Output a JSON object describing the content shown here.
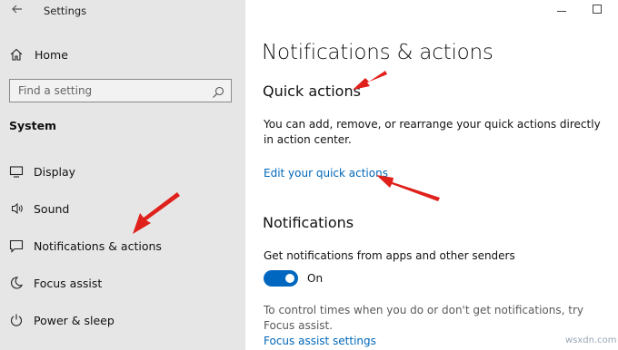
{
  "window": {
    "title": "Settings",
    "back_icon": "back-arrow-icon",
    "controls": [
      "minimize-icon",
      "maximize-icon"
    ]
  },
  "sidebar": {
    "home_label": "Home",
    "search_placeholder": "Find a setting",
    "section_title": "System",
    "items": [
      {
        "label": "Display",
        "icon": "display-icon"
      },
      {
        "label": "Sound",
        "icon": "sound-icon"
      },
      {
        "label": "Notifications & actions",
        "icon": "notifications-icon"
      },
      {
        "label": "Focus assist",
        "icon": "moon-icon"
      },
      {
        "label": "Power & sleep",
        "icon": "power-icon"
      }
    ]
  },
  "main": {
    "page_title": "Notifications & actions",
    "quick_actions": {
      "heading": "Quick actions",
      "description": "You can add, remove, or rearrange your quick actions directly in action center.",
      "link": "Edit your quick actions"
    },
    "notifications": {
      "heading": "Notifications",
      "setting_label": "Get notifications from apps and other senders",
      "toggle_state": "On",
      "focus_text": "To control times when you do or don't get notifications, try Focus assist.",
      "focus_link": "Focus assist settings"
    }
  },
  "watermark": "wsxdn.com",
  "colors": {
    "sidebar_bg": "#e6e6e6",
    "accent": "#0067c0",
    "link": "#0067b8",
    "annotation_arrow": "#e0201b"
  }
}
